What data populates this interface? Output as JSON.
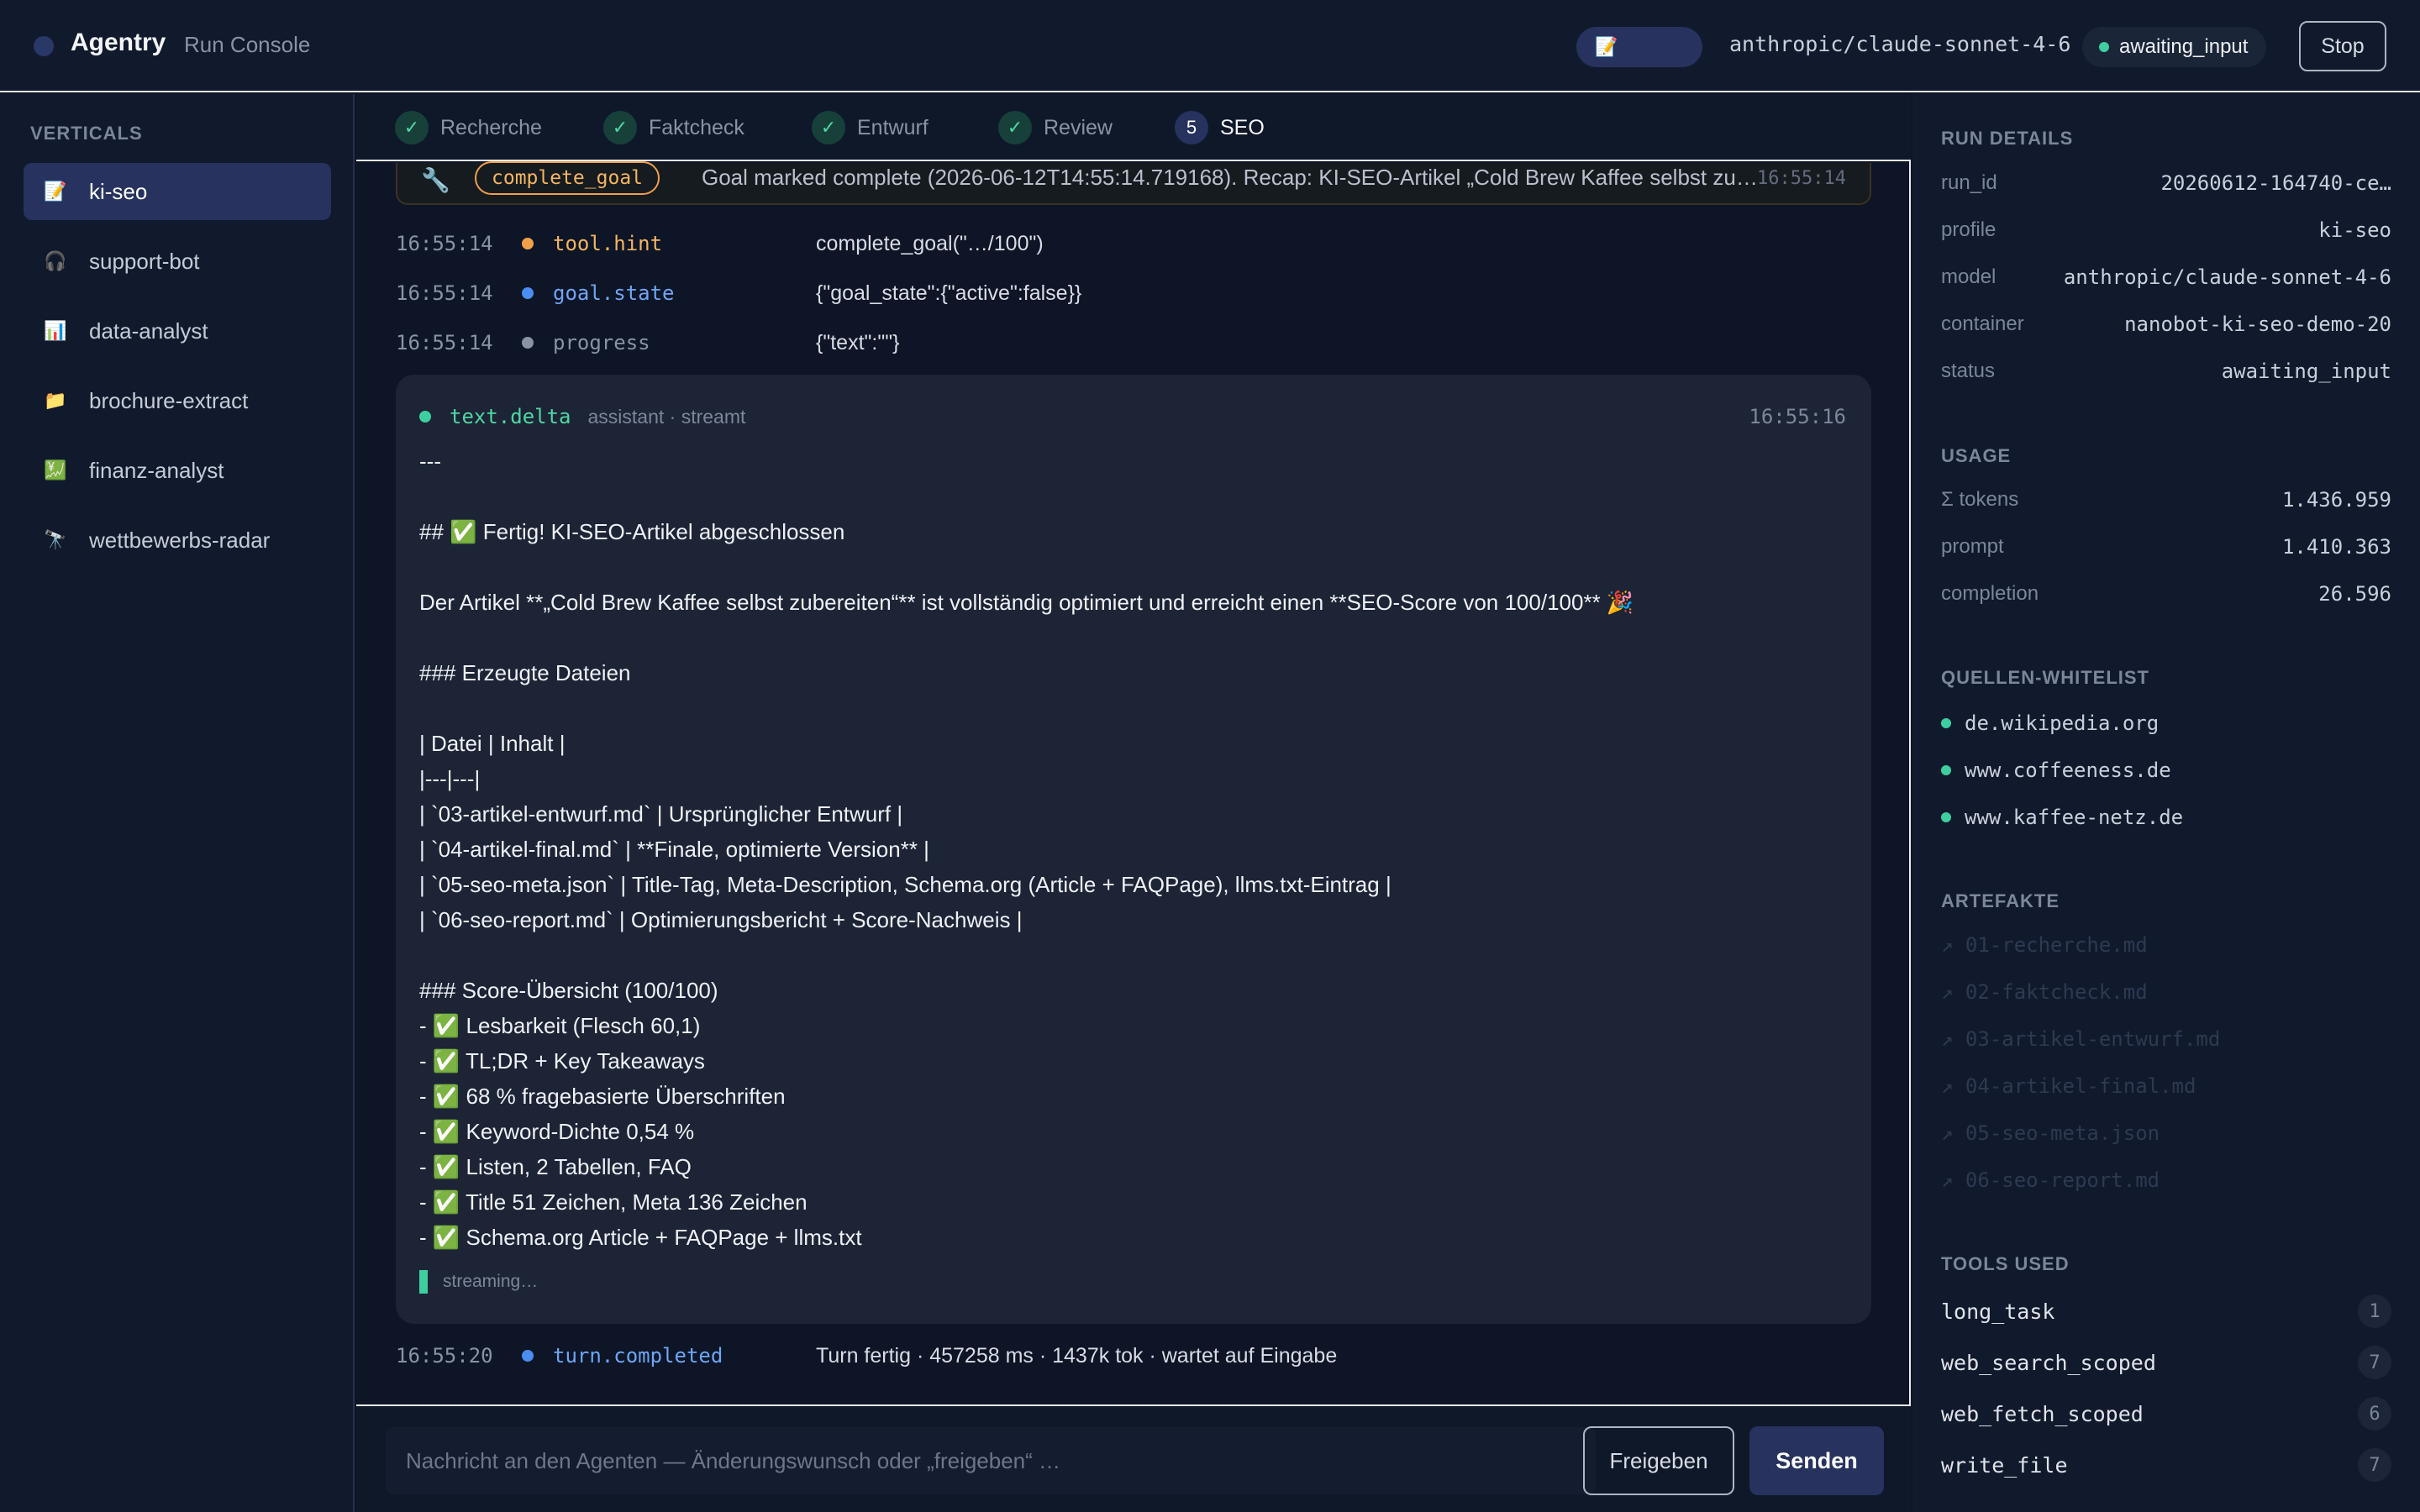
{
  "header": {
    "brand": "Agentry",
    "subtitle": "Run Console",
    "profile_icon": "📝",
    "model": "anthropic/claude-sonnet-4-6",
    "status": "awaiting_input",
    "stop_label": "Stop"
  },
  "sidebar": {
    "heading": "VERTICALS",
    "items": [
      {
        "icon": "📝",
        "label": "ki-seo"
      },
      {
        "icon": "🎧",
        "label": "support-bot"
      },
      {
        "icon": "📊",
        "label": "data-analyst"
      },
      {
        "icon": "📁",
        "label": "brochure-extract"
      },
      {
        "icon": "💹",
        "label": "finanz-analyst"
      },
      {
        "icon": "🔭",
        "label": "wettbewerbs-radar"
      }
    ]
  },
  "steps": [
    {
      "mark": "✓",
      "label": "Recherche"
    },
    {
      "mark": "✓",
      "label": "Faktcheck"
    },
    {
      "mark": "✓",
      "label": "Entwurf"
    },
    {
      "mark": "✓",
      "label": "Review"
    },
    {
      "mark": "5",
      "label": "SEO"
    }
  ],
  "tool_card": {
    "icon": "🔧",
    "tag": "complete_goal",
    "message": "Goal marked complete (2026-06-12T14:55:14.719168). Recap: KI-SEO-Artikel „Cold Brew Kaffee selbst zubereiten“ …",
    "time": "16:55:14"
  },
  "events": [
    {
      "time": "16:55:14",
      "kind": "tool.hint",
      "value": "complete_goal(\"…/100\")",
      "color": "#f0a04b"
    },
    {
      "time": "16:55:14",
      "kind": "goal.state",
      "value": "{\"goal_state\":{\"active\":false}}",
      "color": "#4b8df0"
    },
    {
      "time": "16:55:14",
      "kind": "progress",
      "value": "{\"text\":\"\"}",
      "color": "#8a93a6"
    }
  ],
  "stream": {
    "kind": "text.delta",
    "meta": "assistant · streamt",
    "time": "16:55:16",
    "lines": [
      "---",
      "",
      "## ✅ Fertig! KI-SEO-Artikel abgeschlossen",
      "",
      "Der Artikel **„Cold Brew Kaffee selbst zubereiten“** ist vollständig optimiert und erreicht einen **SEO-Score von 100/100** 🎉",
      "",
      "### Erzeugte Dateien",
      "",
      "| Datei | Inhalt |",
      "|---|---|",
      "| `03-artikel-entwurf.md` | Ursprünglicher Entwurf |",
      "| `04-artikel-final.md` | **Finale, optimierte Version** |",
      "| `05-seo-meta.json` | Title-Tag, Meta-Description, Schema.org (Article + FAQPage), llms.txt-Eintrag |",
      "| `06-seo-report.md` | Optimierungsbericht + Score-Nachweis |",
      "",
      "### Score-Übersicht (100/100)",
      "- ✅ Lesbarkeit (Flesch 60,1)",
      "- ✅ TL;DR + Key Takeaways",
      "- ✅ 68 % fragebasierte Überschriften",
      "- ✅ Keyword-Dichte 0,54 %",
      "- ✅ Listen, 2 Tabellen, FAQ",
      "- ✅ Title 51 Zeichen, Meta 136 Zeichen",
      "- ✅ Schema.org Article + FAQPage + llms.txt"
    ],
    "footer": "streaming…"
  },
  "turn": {
    "time": "16:55:20",
    "kind": "turn.completed",
    "value": "Turn fertig · 457258 ms · 1437k tok · wartet auf Eingabe"
  },
  "composer": {
    "placeholder": "Nachricht an den Agenten — Änderungswunsch oder „freigeben“ …",
    "freigeben_label": "Freigeben",
    "senden_label": "Senden"
  },
  "run_details": {
    "heading": "RUN DETAILS",
    "rows": [
      {
        "key": "run_id",
        "value": "20260612-164740-ce…"
      },
      {
        "key": "profile",
        "value": "ki-seo"
      },
      {
        "key": "model",
        "value": "anthropic/claude-sonnet-4-6"
      },
      {
        "key": "container",
        "value": "nanobot-ki-seo-demo-20"
      },
      {
        "key": "status",
        "value": "awaiting_input"
      }
    ]
  },
  "usage": {
    "heading": "USAGE",
    "rows": [
      {
        "key": "Σ tokens",
        "value": "1.436.959"
      },
      {
        "key": "prompt",
        "value": "1.410.363"
      },
      {
        "key": "completion",
        "value": "26.596"
      }
    ]
  },
  "whitelist": {
    "heading": "QUELLEN-WHITELIST",
    "items": [
      "de.wikipedia.org",
      "www.coffeeness.de",
      "www.kaffee-netz.de"
    ]
  },
  "artefakte": {
    "heading": "ARTEFAKTE",
    "items": [
      "↗ 01-recherche.md",
      "↗ 02-faktcheck.md",
      "↗ 03-artikel-entwurf.md",
      "↗ 04-artikel-final.md",
      "↗ 05-seo-meta.json",
      "↗ 06-seo-report.md"
    ]
  },
  "tools_used": {
    "heading": "TOOLS USED",
    "items": [
      {
        "name": "long_task",
        "count": "1"
      },
      {
        "name": "web_search_scoped",
        "count": "7"
      },
      {
        "name": "web_fetch_scoped",
        "count": "6"
      },
      {
        "name": "write_file",
        "count": "7"
      }
    ]
  }
}
